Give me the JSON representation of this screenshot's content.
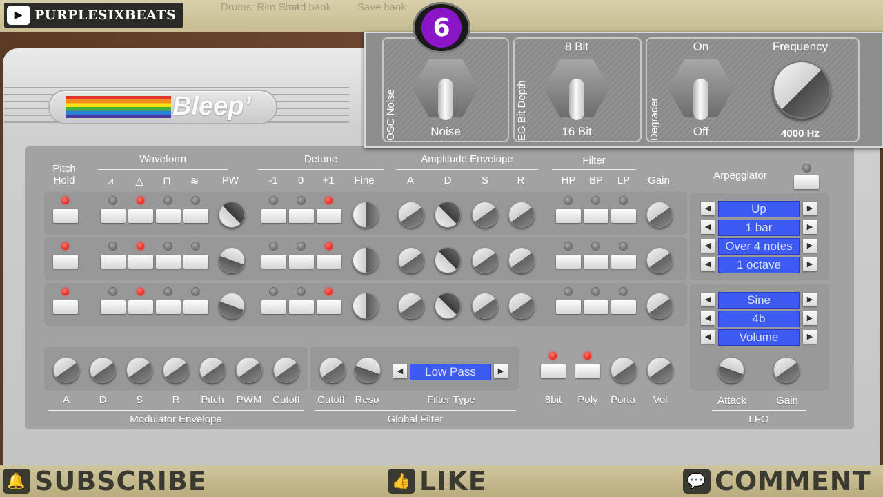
{
  "header": {
    "channel": "PURPLESIXBEATS",
    "host_menu": [
      "Drums: Rim Shot",
      "Load bank",
      "Save bank"
    ]
  },
  "badge": {
    "label": "6"
  },
  "synth": {
    "name": "Bleep’"
  },
  "popup": {
    "osc": {
      "section": "OSC Noise",
      "top": "",
      "bottom": "Noise"
    },
    "eg": {
      "section": "EG Bit Depth",
      "top": "8 Bit",
      "bottom": "16 Bit"
    },
    "deg": {
      "section": "Degrader",
      "top": "On",
      "bottom": "Off",
      "freq_label": "Frequency",
      "freq_value": "4000 Hz"
    }
  },
  "headers": {
    "pitch_hold": "Pitch\nHold",
    "waveform": "Waveform",
    "pw": "PW",
    "detune": "Detune",
    "detune_labels": [
      "-1",
      "0",
      "+1"
    ],
    "fine": "Fine",
    "amp_env": "Amplitude Envelope",
    "amp_labels": [
      "A",
      "D",
      "S",
      "R"
    ],
    "filter": "Filter",
    "filter_labels": [
      "HP",
      "BP",
      "LP"
    ],
    "gain": "Gain"
  },
  "arpeggiator": {
    "title": "Arpeggiator",
    "items": [
      "Up",
      "1 bar",
      "Over 4 notes",
      "1 octave"
    ]
  },
  "lfo": {
    "items": [
      "Sine",
      "4b",
      "Volume"
    ],
    "attack": "Attack",
    "gain": "Gain",
    "title": "LFO"
  },
  "modulator": {
    "labels": [
      "A",
      "D",
      "S",
      "R",
      "Pitch",
      "PWM",
      "Cutoff"
    ],
    "title": "Modulator Envelope"
  },
  "global_filter": {
    "cutoff": "Cutoff",
    "reso": "Reso",
    "type_label": "Filter Type",
    "type_value": "Low Pass",
    "title": "Global Filter"
  },
  "globals": {
    "bit8": "8bit",
    "poly": "Poly",
    "porta": "Porta",
    "vol": "Vol"
  },
  "footer": {
    "subscribe": "SUBSCRIBE",
    "like": "LIKE",
    "comment": "COMMENT"
  },
  "colors": {
    "lcd": "#3d5bf2",
    "led_on": "#e00000",
    "badge": "#8a16c8"
  }
}
